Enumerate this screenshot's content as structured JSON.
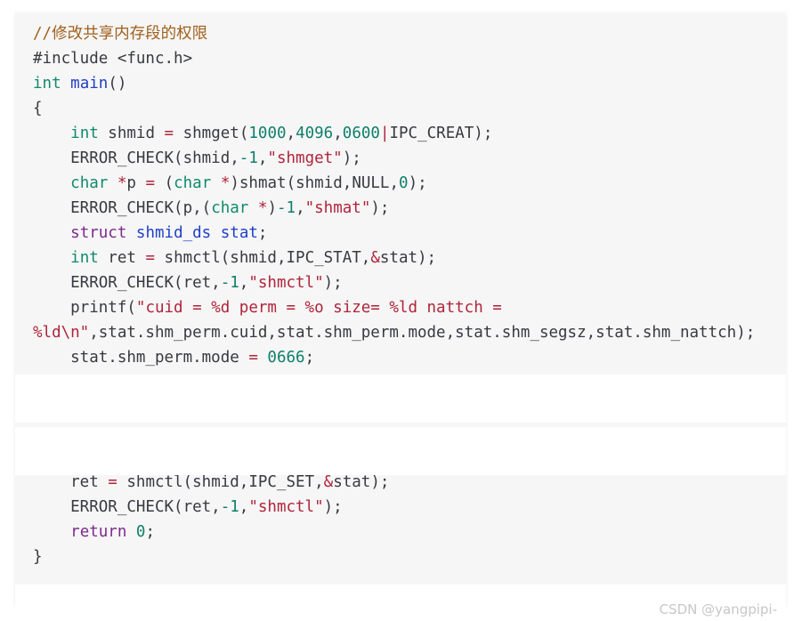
{
  "code": {
    "lines": [
      [
        {
          "t": "//修改共享内存段的权限",
          "c": "comment"
        }
      ],
      [
        {
          "t": "#include <func.h>",
          "c": "plain"
        }
      ],
      [
        {
          "t": "int",
          "c": "type"
        },
        {
          "t": " ",
          "c": "plain"
        },
        {
          "t": "main",
          "c": "func"
        },
        {
          "t": "()",
          "c": "plain"
        }
      ],
      [
        {
          "t": "{",
          "c": "plain"
        }
      ],
      [
        {
          "t": "    ",
          "c": "plain"
        },
        {
          "t": "int",
          "c": "type"
        },
        {
          "t": " shmid ",
          "c": "plain"
        },
        {
          "t": "=",
          "c": "op"
        },
        {
          "t": " shmget(",
          "c": "plain"
        },
        {
          "t": "1000",
          "c": "num"
        },
        {
          "t": ",",
          "c": "plain"
        },
        {
          "t": "4096",
          "c": "num"
        },
        {
          "t": ",",
          "c": "plain"
        },
        {
          "t": "0600",
          "c": "num"
        },
        {
          "t": "|",
          "c": "op"
        },
        {
          "t": "IPC_CREAT);",
          "c": "plain"
        }
      ],
      [
        {
          "t": "    ERROR_CHECK(shmid,",
          "c": "plain"
        },
        {
          "t": "-1",
          "c": "num"
        },
        {
          "t": ",",
          "c": "plain"
        },
        {
          "t": "\"shmget\"",
          "c": "str"
        },
        {
          "t": ");",
          "c": "plain"
        }
      ],
      [
        {
          "t": "    ",
          "c": "plain"
        },
        {
          "t": "char",
          "c": "type"
        },
        {
          "t": " ",
          "c": "plain"
        },
        {
          "t": "*",
          "c": "op"
        },
        {
          "t": "p ",
          "c": "plain"
        },
        {
          "t": "=",
          "c": "op"
        },
        {
          "t": " (",
          "c": "plain"
        },
        {
          "t": "char",
          "c": "type"
        },
        {
          "t": " ",
          "c": "plain"
        },
        {
          "t": "*",
          "c": "op"
        },
        {
          "t": ")shmat(shmid,NULL,",
          "c": "plain"
        },
        {
          "t": "0",
          "c": "num"
        },
        {
          "t": ");",
          "c": "plain"
        }
      ],
      [
        {
          "t": "    ERROR_CHECK(p,(",
          "c": "plain"
        },
        {
          "t": "char",
          "c": "type"
        },
        {
          "t": " ",
          "c": "plain"
        },
        {
          "t": "*",
          "c": "op"
        },
        {
          "t": ")",
          "c": "plain"
        },
        {
          "t": "-1",
          "c": "num"
        },
        {
          "t": ",",
          "c": "plain"
        },
        {
          "t": "\"shmat\"",
          "c": "str"
        },
        {
          "t": ");",
          "c": "plain"
        }
      ],
      [
        {
          "t": "    ",
          "c": "plain"
        },
        {
          "t": "struct",
          "c": "keyword"
        },
        {
          "t": " ",
          "c": "plain"
        },
        {
          "t": "shmid_ds",
          "c": "func"
        },
        {
          "t": " ",
          "c": "plain"
        },
        {
          "t": "stat",
          "c": "func"
        },
        {
          "t": ";",
          "c": "plain"
        }
      ],
      [
        {
          "t": "    ",
          "c": "plain"
        },
        {
          "t": "int",
          "c": "type"
        },
        {
          "t": " ret ",
          "c": "plain"
        },
        {
          "t": "=",
          "c": "op"
        },
        {
          "t": " shmctl(shmid,IPC_STAT,",
          "c": "plain"
        },
        {
          "t": "&",
          "c": "op"
        },
        {
          "t": "stat);",
          "c": "plain"
        }
      ],
      [
        {
          "t": "    ERROR_CHECK(ret,",
          "c": "plain"
        },
        {
          "t": "-1",
          "c": "num"
        },
        {
          "t": ",",
          "c": "plain"
        },
        {
          "t": "\"shmctl\"",
          "c": "str"
        },
        {
          "t": ");",
          "c": "plain"
        }
      ],
      [
        {
          "t": "    printf(",
          "c": "plain"
        },
        {
          "t": "\"cuid = %d perm = %o size= %ld nattch =",
          "c": "str"
        }
      ],
      [
        {
          "t": "%ld\\n\"",
          "c": "str"
        },
        {
          "t": ",stat.shm_perm.cuid,stat.shm_perm.mode,stat.shm_segsz,stat.shm_nattch);",
          "c": "plain"
        }
      ],
      [
        {
          "t": "    stat.shm_perm.mode ",
          "c": "plain"
        },
        {
          "t": "=",
          "c": "op"
        },
        {
          "t": " ",
          "c": "plain"
        },
        {
          "t": "0666",
          "c": "num"
        },
        {
          "t": ";",
          "c": "plain"
        }
      ],
      [],
      [],
      [],
      [],
      [
        {
          "t": "    ret ",
          "c": "plain"
        },
        {
          "t": "=",
          "c": "op"
        },
        {
          "t": " shmctl(shmid,IPC_SET,",
          "c": "plain"
        },
        {
          "t": "&",
          "c": "op"
        },
        {
          "t": "stat);",
          "c": "plain"
        }
      ],
      [
        {
          "t": "    ERROR_CHECK(ret,",
          "c": "plain"
        },
        {
          "t": "-1",
          "c": "num"
        },
        {
          "t": ",",
          "c": "plain"
        },
        {
          "t": "\"shmctl\"",
          "c": "str"
        },
        {
          "t": ");",
          "c": "plain"
        }
      ],
      [
        {
          "t": "    ",
          "c": "plain"
        },
        {
          "t": "return",
          "c": "keyword"
        },
        {
          "t": " ",
          "c": "plain"
        },
        {
          "t": "0",
          "c": "num"
        },
        {
          "t": ";",
          "c": "plain"
        }
      ],
      [
        {
          "t": "}",
          "c": "plain"
        }
      ]
    ]
  },
  "watermark": "CSDN @yangpipi-"
}
